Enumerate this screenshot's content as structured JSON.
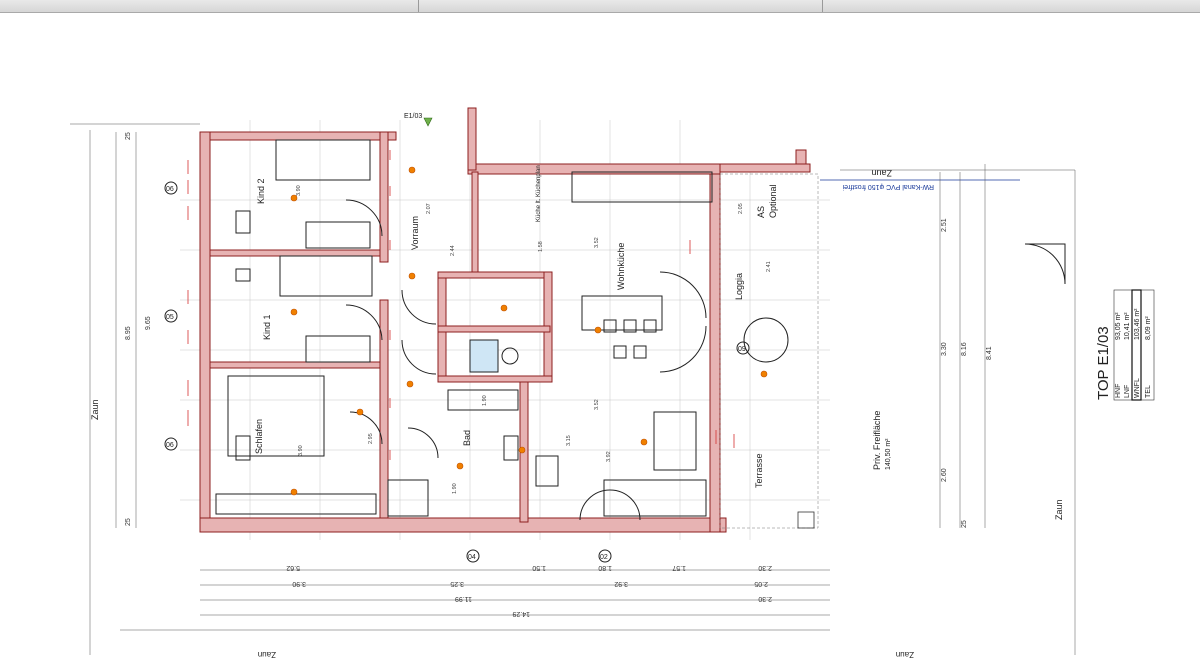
{
  "sheet": {
    "title": "TOP E1/03"
  },
  "area_table": [
    {
      "label": "HNF",
      "value": "93,05 m²"
    },
    {
      "label": "LNF",
      "value": "10,41 m²"
    },
    {
      "label": "WNFL",
      "value": "103,46 m²"
    },
    {
      "label": "TEL",
      "value": "8,09 m²"
    }
  ],
  "rooms": {
    "kind2": "Kind 2",
    "kind1": "Kind 1",
    "schlafen": "Schlafen",
    "vorraum": "Vorraum",
    "wohnkueche": "Wohnküche",
    "bad": "Bad",
    "loggia": "Loggia",
    "terrasse": "Terrasse",
    "freiflaeche": "Priv. Freifläche",
    "freiflaeche_area": "140,50 m²",
    "as": "AS",
    "optional": "Optional",
    "kuechenplan": "Küche lt. Küchenplan"
  },
  "labels": {
    "zaun": "Zaun",
    "rw_kanal": "RW-Kanal PVC φ150 frostfrei",
    "door_code": "E1/03",
    "axis_04": "04",
    "axis_05": "05",
    "axis_06": "06",
    "axis_02": "02",
    "axis_09": "09"
  },
  "dims_left": [
    "8.95",
    "9.65",
    "25",
    "25"
  ],
  "dims_right": [
    "2.51",
    "3.30",
    "8.16",
    "8.41",
    "2.60",
    "25"
  ],
  "dims_bottom_row1": [
    "5.62",
    "1.50",
    "1.80",
    "1.57",
    "2.30"
  ],
  "dims_bottom_row2": [
    "3.90",
    "3.25",
    "3.92",
    "2.05"
  ],
  "dims_bottom_row3": [
    "11.99",
    "2.30"
  ],
  "dims_bottom_total": "14.29",
  "dims_inner": [
    "3.52",
    "3.52",
    "2.07",
    "1.58",
    "2.44",
    "1.90",
    "2.95",
    "3.90",
    "3.90",
    "3.15",
    "1.90",
    "3.92",
    "2.41",
    "2.05"
  ]
}
